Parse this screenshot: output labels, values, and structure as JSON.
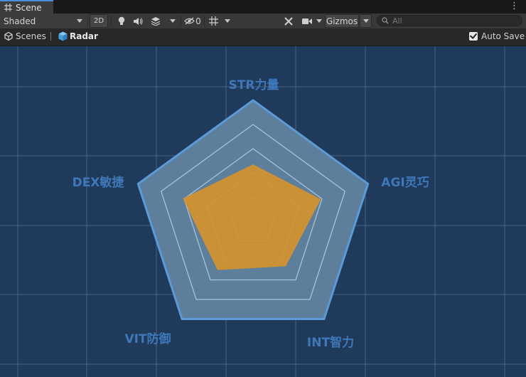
{
  "tab": {
    "title": "Scene",
    "icon": "grid-icon"
  },
  "toolbar": {
    "shading_mode": "Shaded",
    "mode_2d_label": "2D",
    "hidden_count": "0",
    "gizmos_label": "Gizmos",
    "search_placeholder": "All"
  },
  "breadcrumb": {
    "root": "Scenes",
    "current": "Radar",
    "auto_save_label": "Auto Save",
    "auto_save_checked": true
  },
  "chart_data": {
    "type": "radar",
    "axes": [
      "STR力量",
      "AGI灵巧",
      "INT智力",
      "VIT防御",
      "DEX敏捷"
    ],
    "rings": [
      0.2,
      0.4,
      0.6,
      0.8
    ],
    "max": 1,
    "series": [
      {
        "values": [
          0.47,
          0.59,
          0.46,
          0.5,
          0.61
        ]
      }
    ],
    "colors": {
      "frame_fill": "#5d7f9c",
      "frame_stroke": "#5b9ad6",
      "ring": "#a9c2d6",
      "data": "#d4932e",
      "label": "#3e78b8",
      "background": "#1f3a5b"
    }
  }
}
